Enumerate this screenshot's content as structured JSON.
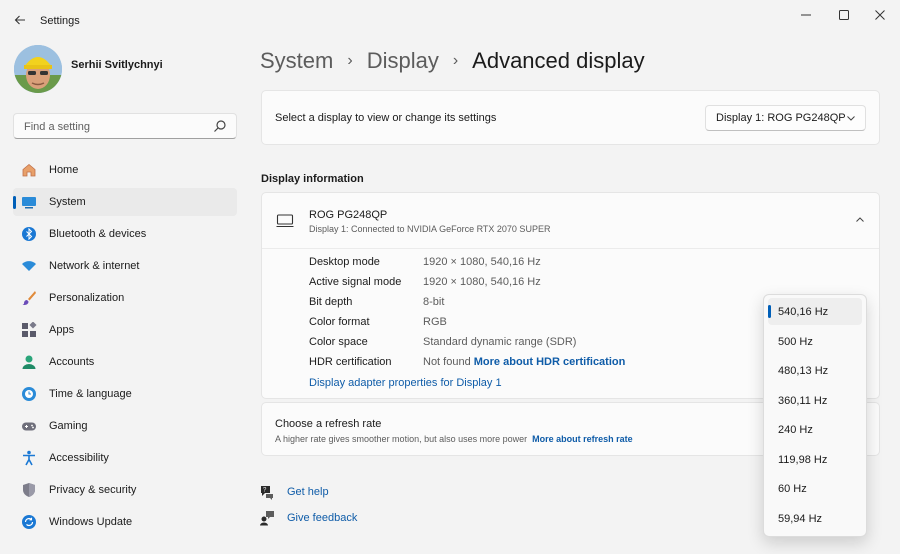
{
  "window": {
    "title": "Settings"
  },
  "user": {
    "name": "Serhii Svitlychnyi"
  },
  "search": {
    "placeholder": "Find a setting"
  },
  "sidebar": {
    "items": [
      {
        "label": "Home",
        "icon": "home-icon"
      },
      {
        "label": "System",
        "icon": "system-icon",
        "active": true
      },
      {
        "label": "Bluetooth & devices",
        "icon": "bluetooth-icon"
      },
      {
        "label": "Network & internet",
        "icon": "wifi-icon"
      },
      {
        "label": "Personalization",
        "icon": "brush-icon"
      },
      {
        "label": "Apps",
        "icon": "apps-icon"
      },
      {
        "label": "Accounts",
        "icon": "account-icon"
      },
      {
        "label": "Time & language",
        "icon": "globe-clock-icon"
      },
      {
        "label": "Gaming",
        "icon": "gamepad-icon"
      },
      {
        "label": "Accessibility",
        "icon": "accessibility-icon"
      },
      {
        "label": "Privacy & security",
        "icon": "shield-icon"
      },
      {
        "label": "Windows Update",
        "icon": "update-icon"
      }
    ]
  },
  "breadcrumb": {
    "part1": "System",
    "part2": "Display",
    "current": "Advanced display"
  },
  "display_select": {
    "label": "Select a display to view or change its settings",
    "value": "Display 1: ROG PG248QP"
  },
  "display_info": {
    "section_title": "Display information",
    "monitor_name": "ROG PG248QP",
    "monitor_sub": "Display 1: Connected to NVIDIA GeForce RTX 2070 SUPER",
    "rows": [
      {
        "key": "Desktop mode",
        "value": "1920 × 1080, 540,16 Hz"
      },
      {
        "key": "Active signal mode",
        "value": "1920 × 1080, 540,16 Hz"
      },
      {
        "key": "Bit depth",
        "value": "8-bit"
      },
      {
        "key": "Color format",
        "value": "RGB"
      },
      {
        "key": "Color space",
        "value": "Standard dynamic range (SDR)"
      },
      {
        "key": "HDR certification",
        "value": "Not found",
        "link": "More about HDR certification"
      }
    ],
    "adapter_link": "Display adapter properties for Display 1"
  },
  "refresh": {
    "title": "Choose a refresh rate",
    "subtitle": "A higher rate gives smoother motion, but also uses more power",
    "link": "More about refresh rate",
    "options": [
      "540,16 Hz",
      "500 Hz",
      "480,13 Hz",
      "360,11 Hz",
      "240 Hz",
      "119,98 Hz",
      "60 Hz",
      "59,94 Hz"
    ],
    "selected": "540,16 Hz"
  },
  "help": {
    "get_help": "Get help",
    "give_feedback": "Give feedback"
  },
  "colors": {
    "accent": "#005fb8",
    "link": "#0f5ca8"
  }
}
